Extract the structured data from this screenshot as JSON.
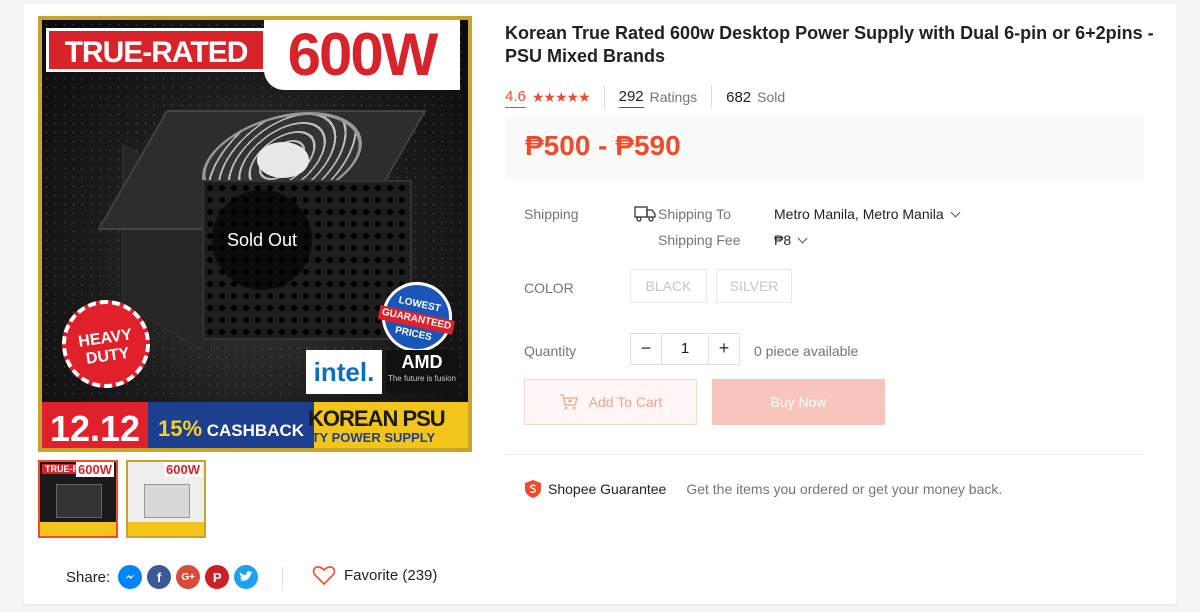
{
  "gallery": {
    "badge_true_rated": "TRUE-RATED",
    "badge_watt": "600W",
    "overlay_sold_out": "Sold Out",
    "badge_heavy_duty": "HEAVY DUTY",
    "badge_lowest": "LOWEST",
    "badge_guaranteed": "GUARANTEED",
    "badge_prices": "PRICES",
    "logo_intel": "intel.",
    "logo_amd": "AMD",
    "logo_amd_tag": "The future is fusion",
    "banner_date": "12.12",
    "banner_cashback_pct": "15%",
    "banner_cashback": "CASHBACK",
    "banner_korean": "KOREAN PSU",
    "banner_sub": "ITY POWER SUPPLY",
    "thumbnails": [
      {
        "tag": "TRUE-RATED",
        "watt": "600W"
      },
      {
        "tag": "",
        "watt": "600W"
      }
    ]
  },
  "share": {
    "label": "Share:",
    "icons": [
      "messenger-icon",
      "facebook-icon",
      "google-plus-icon",
      "pinterest-icon",
      "twitter-icon"
    ]
  },
  "favorite": {
    "label": "Favorite (239)"
  },
  "product": {
    "title": "Korean True Rated 600w Desktop Power Supply with Dual 6-pin or 6+2pins - PSU Mixed Brands",
    "rating": "4.6",
    "stars": "★★★★★",
    "ratings_count": "292",
    "ratings_label": "Ratings",
    "sold_count": "682",
    "sold_label": "Sold",
    "price": "₱500 - ₱590"
  },
  "shipping": {
    "label": "Shipping",
    "to_label": "Shipping To",
    "to_value": "Metro Manila, Metro Manila",
    "fee_label": "Shipping Fee",
    "fee_value": "₱8"
  },
  "color": {
    "label": "COLOR",
    "options": [
      "BLACK",
      "SILVER"
    ]
  },
  "quantity": {
    "label": "Quantity",
    "minus": "−",
    "value": "1",
    "plus": "+",
    "available": "0 piece available"
  },
  "actions": {
    "add_to_cart": "Add To Cart",
    "buy_now": "Buy Now"
  },
  "guarantee": {
    "title": "Shopee Guarantee",
    "text": "Get the items you ordered or get your money back."
  },
  "colors": {
    "accent": "#ee4d2d",
    "price_bg": "#fafafa",
    "buy_disabled": "#f7c5bb"
  }
}
